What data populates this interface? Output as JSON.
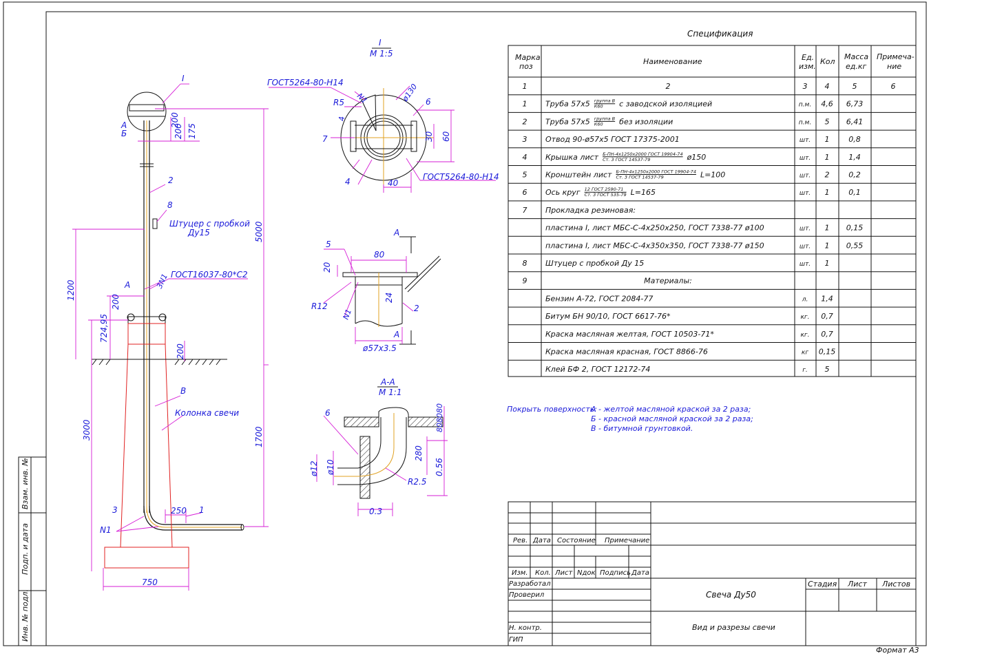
{
  "sheet": {
    "format_label": "Формат А3",
    "side_stamp": [
      "Взам. инв. №",
      "Подп. и дата",
      "Инв. № подл."
    ]
  },
  "elevation": {
    "node_label": "I",
    "label_a": "А",
    "label_b": "Б",
    "label_v": "В",
    "callouts": {
      "c2": "2",
      "c8": "8",
      "c3": "3",
      "c1": "1",
      "n1": "N1",
      "n1b": "3N1"
    },
    "fitting_note": [
      "Штуцер с пробкой",
      "Ду15"
    ],
    "gost_note": "ГОСТ16037-80*С2",
    "column_note": "Колонка свечи",
    "dims": {
      "d200a": "200",
      "d200b": "200",
      "d175": "175",
      "d5000": "5000",
      "d1200": "1200",
      "d200c": "200",
      "d72495": "724,95",
      "d200d": "200",
      "d3000": "3000",
      "d1700": "1700",
      "d250": "250",
      "d750": "750"
    }
  },
  "detail_i": {
    "title": "I",
    "scale": "М 1:5",
    "gost_top": "ГОСТ5264-80-Н14",
    "gost_bottom": "ГОСТ5264-80-Н14",
    "labels": {
      "r5": "R5",
      "n1": "N1",
      "d130": "ø130",
      "c6": "6",
      "c4a": "4",
      "c7": "7",
      "c4b": "4",
      "d30": "30",
      "d60": "60",
      "d40": "40"
    }
  },
  "detail_a": {
    "cut_top": "А",
    "cut_bottom": "А",
    "labels": {
      "c5": "5",
      "d80": "80",
      "d20": "20",
      "d24": "24",
      "r12": "R12",
      "n1": "N1",
      "c2": "2",
      "d57": "ø57х3.5"
    }
  },
  "section_aa": {
    "title": "А-А",
    "scale": "М 1:1",
    "labels": {
      "c6": "6",
      "d280": "280",
      "d056": "0.56",
      "d12": "ø12",
      "d10": "ø10",
      "r25": "R2.5",
      "d03": "0.3",
      "d80": "808080"
    }
  },
  "spec": {
    "title": "Спецификация",
    "headers": {
      "mark": [
        "Марка",
        "поз"
      ],
      "name": "Наименование",
      "unit": [
        "Ед.",
        "изм."
      ],
      "qty": "Кол",
      "mass": [
        "Масса",
        "ед.кг"
      ],
      "note": [
        "Примеча-",
        "ние"
      ]
    },
    "colnums": [
      "1",
      "2",
      "3",
      "4",
      "5",
      "6"
    ],
    "rows": [
      {
        "mark": "1",
        "name": "Труба 57х5",
        "frac_top": "группа В",
        "frac_bot": "К60",
        "name_tail": "с заводской изоляцией",
        "unit": "п.м.",
        "qty": "4,6",
        "mass": "6,73",
        "note": ""
      },
      {
        "mark": "2",
        "name": "Труба 57х5",
        "frac_top": "группа В",
        "frac_bot": "К60",
        "name_tail": "без изоляции",
        "unit": "п.м.",
        "qty": "5",
        "mass": "6,41",
        "note": ""
      },
      {
        "mark": "3",
        "name": "Отвод 90-ø57х5  ГОСТ 17375-2001",
        "frac_top": "",
        "frac_bot": "",
        "name_tail": "",
        "unit": "шт.",
        "qty": "1",
        "mass": "0,8",
        "note": ""
      },
      {
        "mark": "4",
        "name": "Крышка  лист",
        "frac_top": "Б-ПН-4х1250х2000  ГОСТ 19904-74",
        "frac_bot": "Ст. 3  ГОСТ 14537-79",
        "name_tail": "ø150",
        "unit": "шт.",
        "qty": "1",
        "mass": "1,4",
        "note": ""
      },
      {
        "mark": "5",
        "name": "Кронштейн  лист",
        "frac_top": "Б-ПН-4х1250х2000  ГОСТ 19904-74",
        "frac_bot": "Ст. 3  ГОСТ 14537-79",
        "name_tail": "L=100",
        "unit": "шт.",
        "qty": "2",
        "mass": "0,2",
        "note": ""
      },
      {
        "mark": "6",
        "name": "Ось  круг",
        "frac_top": "12  ГОСТ 2590-71",
        "frac_bot": "Ст. 3  ГОСТ 535-79",
        "name_tail": "L=165",
        "unit": "шт.",
        "qty": "1",
        "mass": "0,1",
        "note": ""
      },
      {
        "mark": "7",
        "name": "Прокладка  резиновая:",
        "frac_top": "",
        "frac_bot": "",
        "name_tail": "",
        "unit": "",
        "qty": "",
        "mass": "",
        "note": ""
      },
      {
        "mark": "",
        "name": "пластина I,  лист  МБС-С-4х250х250,  ГОСТ 7338-77  ø100",
        "frac_top": "",
        "frac_bot": "",
        "name_tail": "",
        "unit": "шт.",
        "qty": "1",
        "mass": "0,15",
        "note": ""
      },
      {
        "mark": "",
        "name": "пластина I,  лист  МБС-С-4х350х350,  ГОСТ 7338-77  ø150",
        "frac_top": "",
        "frac_bot": "",
        "name_tail": "",
        "unit": "шт.",
        "qty": "1",
        "mass": "0,55",
        "note": ""
      },
      {
        "mark": "8",
        "name": "Штуцер  с  пробкой  Ду 15",
        "frac_top": "",
        "frac_bot": "",
        "name_tail": "",
        "unit": "шт.",
        "qty": "1",
        "mass": "",
        "note": ""
      },
      {
        "mark": "9",
        "name": "Материалы:",
        "frac_top": "",
        "frac_bot": "",
        "name_tail": "",
        "unit": "",
        "qty": "",
        "mass": "",
        "note": "",
        "center": true
      },
      {
        "mark": "",
        "name": "Бензин  А-72,  ГОСТ 2084-77",
        "frac_top": "",
        "frac_bot": "",
        "name_tail": "",
        "unit": "л.",
        "qty": "1,4",
        "mass": "",
        "note": ""
      },
      {
        "mark": "",
        "name": "Битум  БН 90/10,  ГОСТ 6617-76*",
        "frac_top": "",
        "frac_bot": "",
        "name_tail": "",
        "unit": "кг.",
        "qty": "0,7",
        "mass": "",
        "note": ""
      },
      {
        "mark": "",
        "name": "Краска  масляная  желтая,  ГОСТ 10503-71*",
        "frac_top": "",
        "frac_bot": "",
        "name_tail": "",
        "unit": "кг.",
        "qty": "0,7",
        "mass": "",
        "note": ""
      },
      {
        "mark": "",
        "name": "Краска  масляная  красная,  ГОСТ 8866-76",
        "frac_top": "",
        "frac_bot": "",
        "name_tail": "",
        "unit": "кг",
        "qty": "0,15",
        "mass": "",
        "note": ""
      },
      {
        "mark": "",
        "name": "Клей  БФ 2,  ГОСТ 12172-74",
        "frac_top": "",
        "frac_bot": "",
        "name_tail": "",
        "unit": "г.",
        "qty": "5",
        "mass": "",
        "note": ""
      }
    ]
  },
  "notes": {
    "lead": "Покрыть поверхность:",
    "lines": [
      "А  -  желтой масляной краской за 2 раза;",
      "Б  -  красной масляной краской за 2 раза;",
      "В  -  битумной грунтовкой."
    ]
  },
  "title_block": {
    "rev": "Рев.",
    "date": "Дата",
    "state": "Состояние",
    "remark": "Примечание",
    "izm": "Изм.",
    "kol": "Кол.",
    "list": "Лист",
    "ndok": "Nдок",
    "podpis": "Подпись",
    "data": "Дата",
    "razrabotal": "Разработал",
    "proveril": "Проверил",
    "nkontr": "Н. контр.",
    "gip": "ГИП",
    "object_title": "Свеча Ду50",
    "sheet_title": "Вид и разрезы свечи",
    "stadia": "Стадия",
    "sheet": "Лист",
    "sheets": "Листов"
  }
}
